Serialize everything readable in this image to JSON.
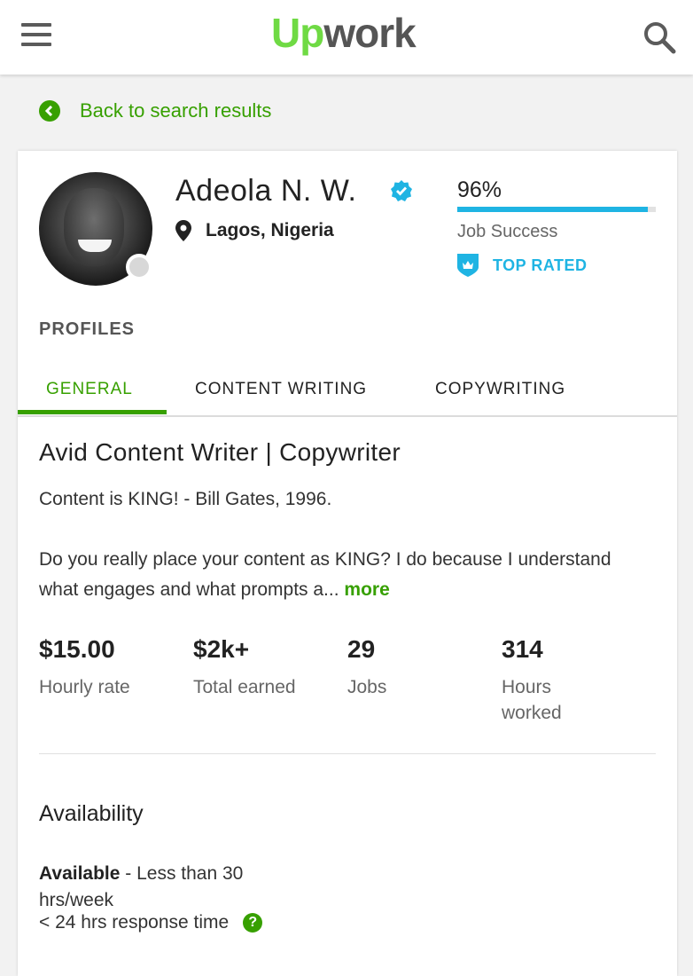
{
  "header": {
    "logo_up": "Up",
    "logo_work": "work"
  },
  "nav": {
    "back_label": "Back to search results"
  },
  "profile": {
    "name": "Adeola N. W.",
    "location": "Lagos, Nigeria",
    "job_success_percent": "96%",
    "job_success_value": 0.96,
    "job_success_label": "Job Success",
    "badge": "TOP RATED",
    "profiles_heading": "PROFILES",
    "tabs": [
      {
        "label": "GENERAL",
        "active": true
      },
      {
        "label": "CONTENT WRITING",
        "active": false
      },
      {
        "label": "COPYWRITING",
        "active": false
      }
    ],
    "title": "Avid Content Writer | Copywriter",
    "quote": "Content is KING! - Bill Gates, 1996.",
    "description": "Do you really place your content as KING? I do because I understand what engages and what prompts a...",
    "more_label": "more",
    "stats": [
      {
        "value": "$15.00",
        "label": "Hourly rate"
      },
      {
        "value": "$2k+",
        "label": "Total earned"
      },
      {
        "value": "29",
        "label": "Jobs"
      },
      {
        "value": "314",
        "label": "Hours worked"
      }
    ],
    "availability": {
      "heading": "Availability",
      "status": "Available",
      "hours": " - Less than 30 hrs/week",
      "response": "< 24 hrs response time",
      "help_glyph": "?"
    }
  },
  "colors": {
    "brand_green": "#37a000",
    "logo_green": "#6fda44",
    "accent_blue": "#1fb4e3"
  },
  "icons": [
    "menu-icon",
    "search-icon",
    "chevron-left-icon",
    "verified-icon",
    "location-pin-icon",
    "top-rated-icon",
    "help-icon"
  ]
}
